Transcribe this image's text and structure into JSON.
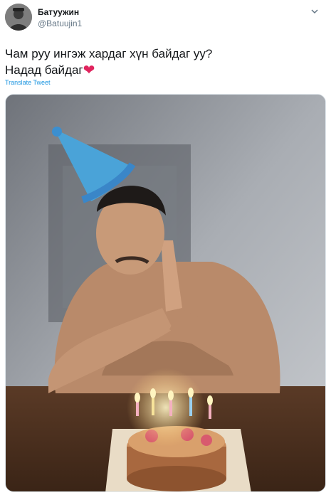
{
  "tweet": {
    "author": {
      "display_name": "Батуужин",
      "handle": "@Batuujin1"
    },
    "text_line_1": "Чам руу ингэж хардаг хүн байдаг уу?",
    "text_line_2": "Надад байдаг",
    "emoji": "❤",
    "translate_label": "Translate Tweet",
    "more_icon": "chevron-down-icon"
  },
  "colors": {
    "link": "#1b95e0",
    "secondary_text": "#657786",
    "heart": "#e0245e"
  }
}
